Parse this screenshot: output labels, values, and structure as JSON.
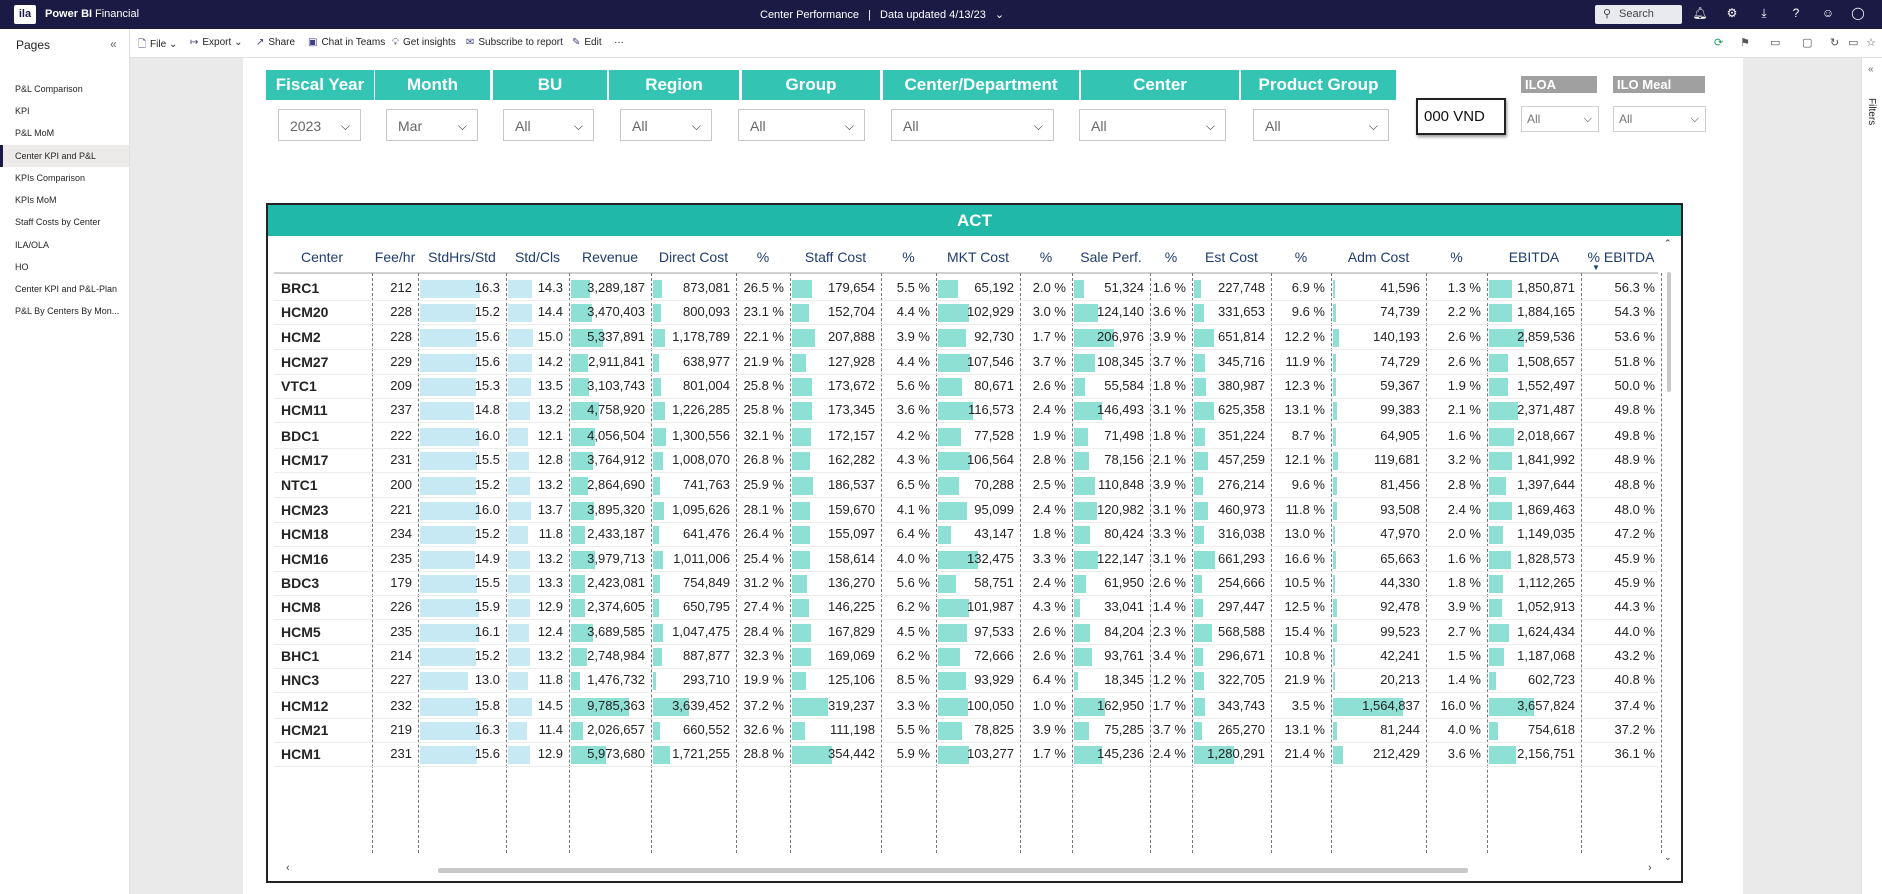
{
  "topbar": {
    "logo": "ila",
    "app": "Power BI",
    "workspace": "Financial",
    "report": "Center Performance",
    "separator": "|",
    "updated": "Data updated 4/13/23",
    "search_placeholder": "Search"
  },
  "commands": {
    "file": "File",
    "export": "Export",
    "share": "Share",
    "chat": "Chat in Teams",
    "insights": "Get insights",
    "subscribe": "Subscribe to report",
    "edit": "Edit",
    "more": "···"
  },
  "pages": {
    "header": "Pages",
    "items": [
      "P&L Comparison",
      "KPI",
      "P&L MoM",
      "Center KPI and P&L",
      "KPIs Comparison",
      "KPIs MoM",
      "Staff Costs by Center",
      "ILA/OLA",
      "HO",
      "Center KPI and P&L-Plan",
      "P&L By Centers By Mon..."
    ],
    "active_index": 3
  },
  "filters_pane": {
    "label": "Filters"
  },
  "slicers": [
    {
      "header": "Fiscal Year",
      "value": "2023"
    },
    {
      "header": "Month",
      "value": "Mar"
    },
    {
      "header": "BU",
      "value": "All"
    },
    {
      "header": "Region",
      "value": "All"
    },
    {
      "header": "Group",
      "value": "All"
    },
    {
      "header": "Center/Department",
      "value": "All"
    },
    {
      "header": "Center",
      "value": "All"
    },
    {
      "header": "Product Group",
      "value": "All"
    }
  ],
  "unit_box": "000 VND",
  "gray_slicers": [
    {
      "header": "ILOA",
      "value": "All"
    },
    {
      "header": "ILO Meal",
      "value": "All"
    }
  ],
  "table": {
    "title": "ACT",
    "columns": [
      "Center",
      "Fee/hr",
      "StdHrs/Std",
      "Std/Cls",
      "Revenue",
      "Direct Cost",
      "%",
      "Staff Cost",
      "%",
      "MKT Cost",
      "%",
      "Sale Perf.",
      "%",
      "Est Cost",
      "%",
      "Adm Cost",
      "%",
      "EBITDA",
      "% EBITDA"
    ],
    "sort_column": "% EBITDA",
    "rows": [
      [
        "BRC1",
        "212",
        "16.3",
        "14.3",
        "3,289,187",
        "873,081",
        "26.5 %",
        "179,654",
        "5.5 %",
        "65,192",
        "2.0 %",
        "51,324",
        "1.6 %",
        "227,748",
        "6.9 %",
        "41,596",
        "1.3 %",
        "1,850,871",
        "56.3 %"
      ],
      [
        "HCM20",
        "228",
        "15.2",
        "14.4",
        "3,470,403",
        "800,093",
        "23.1 %",
        "152,704",
        "4.4 %",
        "102,929",
        "3.0 %",
        "124,140",
        "3.6 %",
        "331,653",
        "9.6 %",
        "74,739",
        "2.2 %",
        "1,884,165",
        "54.3 %"
      ],
      [
        "HCM2",
        "228",
        "15.6",
        "15.0",
        "5,337,891",
        "1,178,789",
        "22.1 %",
        "207,888",
        "3.9 %",
        "92,730",
        "1.7 %",
        "206,976",
        "3.9 %",
        "651,814",
        "12.2 %",
        "140,193",
        "2.6 %",
        "2,859,536",
        "53.6 %"
      ],
      [
        "HCM27",
        "229",
        "15.6",
        "14.2",
        "2,911,841",
        "638,977",
        "21.9 %",
        "127,928",
        "4.4 %",
        "107,546",
        "3.7 %",
        "108,345",
        "3.7 %",
        "345,716",
        "11.9 %",
        "74,729",
        "2.6 %",
        "1,508,657",
        "51.8 %"
      ],
      [
        "VTC1",
        "209",
        "15.3",
        "13.5",
        "3,103,743",
        "801,004",
        "25.8 %",
        "173,672",
        "5.6 %",
        "80,671",
        "2.6 %",
        "55,584",
        "1.8 %",
        "380,987",
        "12.3 %",
        "59,367",
        "1.9 %",
        "1,552,497",
        "50.0 %"
      ],
      [
        "HCM11",
        "237",
        "14.8",
        "13.2",
        "4,758,920",
        "1,226,285",
        "25.8 %",
        "173,345",
        "3.6 %",
        "116,573",
        "2.4 %",
        "146,493",
        "3.1 %",
        "625,358",
        "13.1 %",
        "99,383",
        "2.1 %",
        "2,371,487",
        "49.8 %"
      ],
      [
        "BDC1",
        "222",
        "16.0",
        "12.1",
        "4,056,504",
        "1,300,556",
        "32.1 %",
        "172,157",
        "4.2 %",
        "77,528",
        "1.9 %",
        "71,498",
        "1.8 %",
        "351,224",
        "8.7 %",
        "64,905",
        "1.6 %",
        "2,018,667",
        "49.8 %"
      ],
      [
        "HCM17",
        "231",
        "15.5",
        "12.8",
        "3,764,912",
        "1,008,070",
        "26.8 %",
        "162,282",
        "4.3 %",
        "106,564",
        "2.8 %",
        "78,156",
        "2.1 %",
        "457,259",
        "12.1 %",
        "119,681",
        "3.2 %",
        "1,841,992",
        "48.9 %"
      ],
      [
        "NTC1",
        "200",
        "15.2",
        "13.2",
        "2,864,690",
        "741,763",
        "25.9 %",
        "186,537",
        "6.5 %",
        "70,288",
        "2.5 %",
        "110,848",
        "3.9 %",
        "276,214",
        "9.6 %",
        "81,456",
        "2.8 %",
        "1,397,644",
        "48.8 %"
      ],
      [
        "HCM23",
        "221",
        "16.0",
        "13.7",
        "3,895,320",
        "1,095,626",
        "28.1 %",
        "159,670",
        "4.1 %",
        "95,099",
        "2.4 %",
        "120,982",
        "3.1 %",
        "460,973",
        "11.8 %",
        "93,508",
        "2.4 %",
        "1,869,463",
        "48.0 %"
      ],
      [
        "HCM18",
        "234",
        "15.2",
        "11.8",
        "2,433,187",
        "641,476",
        "26.4 %",
        "155,097",
        "6.4 %",
        "43,147",
        "1.8 %",
        "80,424",
        "3.3 %",
        "316,038",
        "13.0 %",
        "47,970",
        "2.0 %",
        "1,149,035",
        "47.2 %"
      ],
      [
        "HCM16",
        "235",
        "14.9",
        "13.2",
        "3,979,713",
        "1,011,006",
        "25.4 %",
        "158,614",
        "4.0 %",
        "132,475",
        "3.3 %",
        "122,147",
        "3.1 %",
        "661,293",
        "16.6 %",
        "65,663",
        "1.6 %",
        "1,828,573",
        "45.9 %"
      ],
      [
        "BDC3",
        "179",
        "15.5",
        "13.3",
        "2,423,081",
        "754,849",
        "31.2 %",
        "136,270",
        "5.6 %",
        "58,751",
        "2.4 %",
        "61,950",
        "2.6 %",
        "254,666",
        "10.5 %",
        "44,330",
        "1.8 %",
        "1,112,265",
        "45.9 %"
      ],
      [
        "HCM8",
        "226",
        "15.9",
        "12.9",
        "2,374,605",
        "650,795",
        "27.4 %",
        "146,225",
        "6.2 %",
        "101,987",
        "4.3 %",
        "33,041",
        "1.4 %",
        "297,447",
        "12.5 %",
        "92,478",
        "3.9 %",
        "1,052,913",
        "44.3 %"
      ],
      [
        "HCM5",
        "235",
        "16.1",
        "12.4",
        "3,689,585",
        "1,047,475",
        "28.4 %",
        "167,829",
        "4.5 %",
        "97,533",
        "2.6 %",
        "84,204",
        "2.3 %",
        "568,588",
        "15.4 %",
        "99,523",
        "2.7 %",
        "1,624,434",
        "44.0 %"
      ],
      [
        "BHC1",
        "214",
        "15.2",
        "13.2",
        "2,748,984",
        "887,877",
        "32.3 %",
        "169,069",
        "6.2 %",
        "72,666",
        "2.6 %",
        "93,761",
        "3.4 %",
        "296,671",
        "10.8 %",
        "42,241",
        "1.5 %",
        "1,187,068",
        "43.2 %"
      ],
      [
        "HNC3",
        "227",
        "13.0",
        "11.8",
        "1,476,732",
        "293,710",
        "19.9 %",
        "125,106",
        "8.5 %",
        "93,929",
        "6.4 %",
        "18,345",
        "1.2 %",
        "322,705",
        "21.9 %",
        "20,213",
        "1.4 %",
        "602,723",
        "40.8 %"
      ],
      [
        "HCM12",
        "232",
        "15.8",
        "14.5",
        "9,785,363",
        "3,639,452",
        "37.2 %",
        "319,237",
        "3.3 %",
        "100,050",
        "1.0 %",
        "162,950",
        "1.7 %",
        "343,743",
        "3.5 %",
        "1,564,837",
        "16.0 %",
        "3,657,824",
        "37.4 %"
      ],
      [
        "HCM21",
        "219",
        "16.3",
        "11.4",
        "2,026,657",
        "660,552",
        "32.6 %",
        "111,198",
        "5.5 %",
        "78,825",
        "3.9 %",
        "75,285",
        "3.7 %",
        "265,270",
        "13.1 %",
        "81,244",
        "4.0 %",
        "754,618",
        "37.2 %"
      ],
      [
        "HCM1",
        "231",
        "15.6",
        "12.9",
        "5,973,680",
        "1,721,255",
        "28.8 %",
        "354,442",
        "5.9 %",
        "103,277",
        "1.7 %",
        "145,236",
        "2.4 %",
        "1,280,291",
        "21.4 %",
        "212,429",
        "3.6 %",
        "2,156,751",
        "36.1 %"
      ]
    ]
  }
}
